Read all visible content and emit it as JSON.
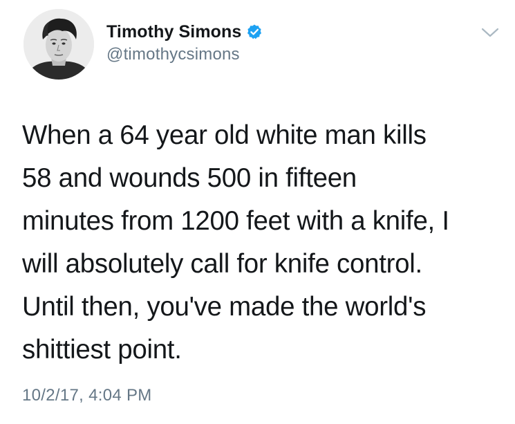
{
  "author": {
    "display_name": "Timothy Simons",
    "handle": "@timothycsimons",
    "verified": true
  },
  "tweet": {
    "lines": [
      "When a 64 year old white man kills",
      "58 and wounds 500 in fifteen",
      "minutes from 1200 feet with a knife, I",
      "will absolutely call for knife control.",
      "Until then, you've made the world's",
      "shittiest point."
    ],
    "timestamp": "10/2/17, 4:04 PM"
  },
  "icons": {
    "avatar": "avatar-photo",
    "verified": "verified-badge-icon",
    "menu": "chevron-down-icon"
  },
  "colors": {
    "text": "#14171a",
    "secondary": "#657786",
    "verified_blue": "#1da1f2",
    "caret": "#aab8c2"
  }
}
